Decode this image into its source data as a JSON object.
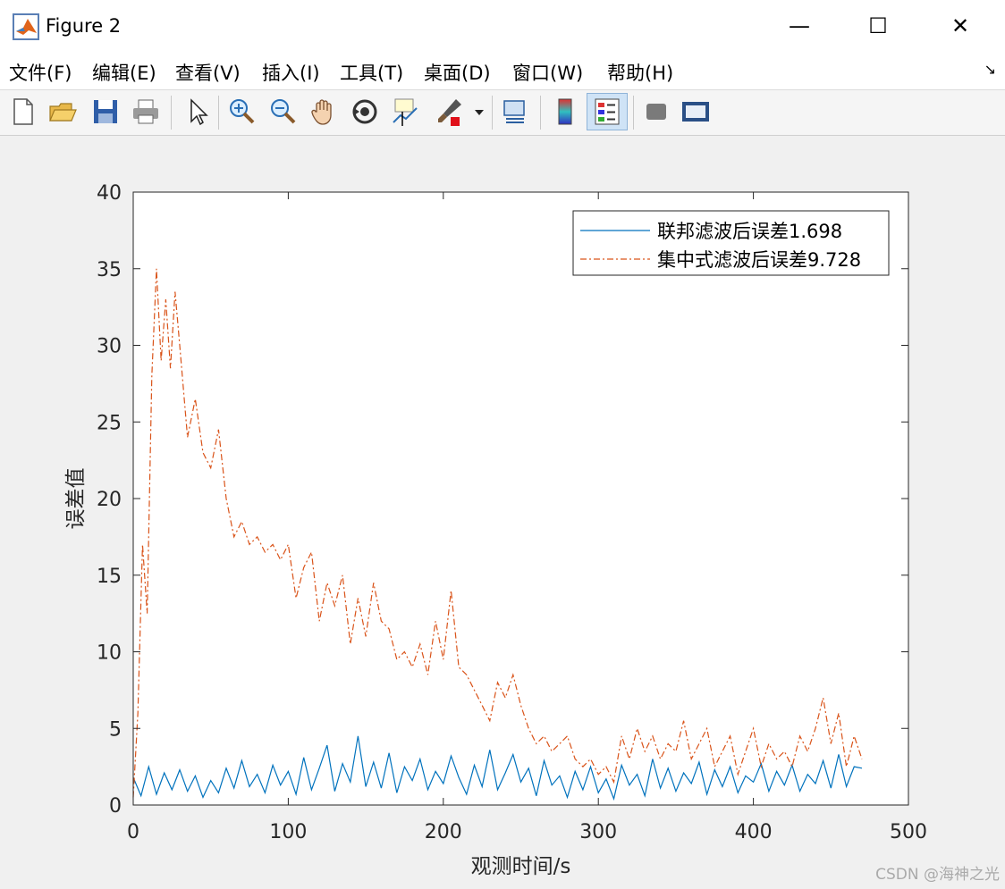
{
  "window": {
    "title": "Figure 2",
    "minimize": "—",
    "maximize": "☐",
    "close": "✕"
  },
  "menu": {
    "items": [
      "文件(F)",
      "编辑(E)",
      "查看(V)",
      "插入(I)",
      "工具(T)",
      "桌面(D)",
      "窗口(W)",
      "帮助(H)"
    ],
    "corner_icon": "dock-arrow-icon"
  },
  "toolbar": {
    "icons": [
      "new-figure-icon",
      "open-file-icon",
      "save-icon",
      "print-icon",
      "select-pointer-icon",
      "zoom-in-icon",
      "zoom-out-icon",
      "pan-hand-icon",
      "rotate-3d-icon",
      "data-cursor-icon",
      "brush-icon",
      "link-plot-icon",
      "colorbar-icon",
      "legend-icon",
      "hide-plot-tools-icon",
      "show-plot-tools-icon"
    ],
    "active": "legend-icon"
  },
  "watermark": "CSDN @海神之光",
  "colors": {
    "series1": "#0072BD",
    "series2": "#D95319",
    "axes": "#262626"
  },
  "chart_data": {
    "type": "line",
    "xlabel": "观测时间/s",
    "ylabel": "误差值",
    "xlim": [
      0,
      500
    ],
    "ylim": [
      0,
      40
    ],
    "xticks": [
      0,
      100,
      200,
      300,
      400,
      500
    ],
    "yticks": [
      0,
      5,
      10,
      15,
      20,
      25,
      30,
      35,
      40
    ],
    "grid": false,
    "legend_position": "top-right",
    "series": [
      {
        "name": "联邦滤波后误差1.698",
        "style": "solid",
        "x": [
          0,
          5,
          10,
          15,
          20,
          25,
          30,
          35,
          40,
          45,
          50,
          55,
          60,
          65,
          70,
          75,
          80,
          85,
          90,
          95,
          100,
          105,
          110,
          115,
          120,
          125,
          130,
          135,
          140,
          145,
          150,
          155,
          160,
          165,
          170,
          175,
          180,
          185,
          190,
          195,
          200,
          205,
          210,
          215,
          220,
          225,
          230,
          235,
          240,
          245,
          250,
          255,
          260,
          265,
          270,
          275,
          280,
          285,
          290,
          295,
          300,
          305,
          310,
          315,
          320,
          325,
          330,
          335,
          340,
          345,
          350,
          355,
          360,
          365,
          370,
          375,
          380,
          385,
          390,
          395,
          400,
          405,
          410,
          415,
          420,
          425,
          430,
          435,
          440,
          445,
          450,
          455,
          460,
          465,
          470
        ],
        "y": [
          1.8,
          0.6,
          2.5,
          0.7,
          2.1,
          1.0,
          2.3,
          0.9,
          1.9,
          0.5,
          1.6,
          0.8,
          2.4,
          1.1,
          2.9,
          1.2,
          2.0,
          0.8,
          2.6,
          1.3,
          2.2,
          0.7,
          3.1,
          1.0,
          2.4,
          3.9,
          0.9,
          2.7,
          1.5,
          4.5,
          1.2,
          2.8,
          1.1,
          3.4,
          0.8,
          2.5,
          1.6,
          3.0,
          1.0,
          2.2,
          1.4,
          3.2,
          1.8,
          0.7,
          2.6,
          1.2,
          3.6,
          1.0,
          2.1,
          3.3,
          1.5,
          2.4,
          0.6,
          2.9,
          1.3,
          1.9,
          0.5,
          2.2,
          1.0,
          2.5,
          0.8,
          1.7,
          0.4,
          2.6,
          1.3,
          2.0,
          0.6,
          3.0,
          1.1,
          2.4,
          0.9,
          2.1,
          1.4,
          2.8,
          0.7,
          2.3,
          1.2,
          2.5,
          0.8,
          1.9,
          1.5,
          2.7,
          0.9,
          2.2,
          1.3,
          2.6,
          0.9,
          2.0,
          1.4,
          2.9,
          1.1,
          3.3,
          1.2,
          2.5,
          2.4
        ]
      },
      {
        "name": "集中式滤波后误差9.728",
        "style": "dashdot",
        "x": [
          0,
          3,
          6,
          9,
          12,
          15,
          18,
          21,
          24,
          27,
          30,
          35,
          40,
          45,
          50,
          55,
          60,
          65,
          70,
          75,
          80,
          85,
          90,
          95,
          100,
          105,
          110,
          115,
          120,
          125,
          130,
          135,
          140,
          145,
          150,
          155,
          160,
          165,
          170,
          175,
          180,
          185,
          190,
          195,
          200,
          205,
          210,
          215,
          220,
          225,
          230,
          235,
          240,
          245,
          250,
          255,
          260,
          265,
          270,
          275,
          280,
          285,
          290,
          295,
          300,
          305,
          310,
          315,
          320,
          325,
          330,
          335,
          340,
          345,
          350,
          355,
          360,
          365,
          370,
          375,
          380,
          385,
          390,
          395,
          400,
          405,
          410,
          415,
          420,
          425,
          430,
          435,
          440,
          445,
          450,
          455,
          460,
          465,
          470
        ],
        "y": [
          0.5,
          6.0,
          17.0,
          12.5,
          28.0,
          35.0,
          29.0,
          33.0,
          28.5,
          33.5,
          30.0,
          24.0,
          26.5,
          23.0,
          22.0,
          24.5,
          20.0,
          17.5,
          18.5,
          17.0,
          17.5,
          16.5,
          17.0,
          16.0,
          17.0,
          13.5,
          15.5,
          16.5,
          12.0,
          14.5,
          13.0,
          15.0,
          10.5,
          13.5,
          11.0,
          14.5,
          12.0,
          11.5,
          9.5,
          10.0,
          9.0,
          10.5,
          8.5,
          12.0,
          9.5,
          14.0,
          9.0,
          8.5,
          7.5,
          6.5,
          5.5,
          8.0,
          7.0,
          8.5,
          6.5,
          5.0,
          4.0,
          4.5,
          3.5,
          4.0,
          4.5,
          3.0,
          2.5,
          3.0,
          2.0,
          2.5,
          1.5,
          4.5,
          3.0,
          5.0,
          3.5,
          4.5,
          3.0,
          4.0,
          3.5,
          5.5,
          3.0,
          4.0,
          5.0,
          2.5,
          3.5,
          4.5,
          2.0,
          3.5,
          5.0,
          2.5,
          4.0,
          3.0,
          3.5,
          2.5,
          4.5,
          3.5,
          5.0,
          7.0,
          4.0,
          6.0,
          2.5,
          4.5,
          3.0
        ]
      }
    ]
  }
}
